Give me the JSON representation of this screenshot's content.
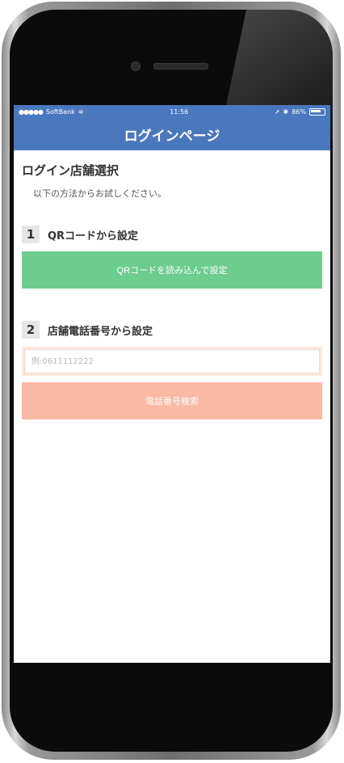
{
  "status_bar": {
    "carrier": "SoftBank",
    "time": "11:56",
    "battery": "86%"
  },
  "nav": {
    "title": "ログインページ"
  },
  "page": {
    "title": "ログイン店舗選択",
    "subtitle": "以下の方法からお試しください。"
  },
  "section1": {
    "number": "1",
    "label": "QRコードから設定",
    "button_label": "QRコードを読み込んで設定"
  },
  "section2": {
    "number": "2",
    "label": "店舗電話番号から設定",
    "input_placeholder": "例:0611112222",
    "button_label": "電話番号検索"
  },
  "colors": {
    "header": "#4a78bf",
    "qr_button": "#6ccd8e",
    "search_button": "#f9b9a4",
    "input_border": "#fbe9dd"
  }
}
